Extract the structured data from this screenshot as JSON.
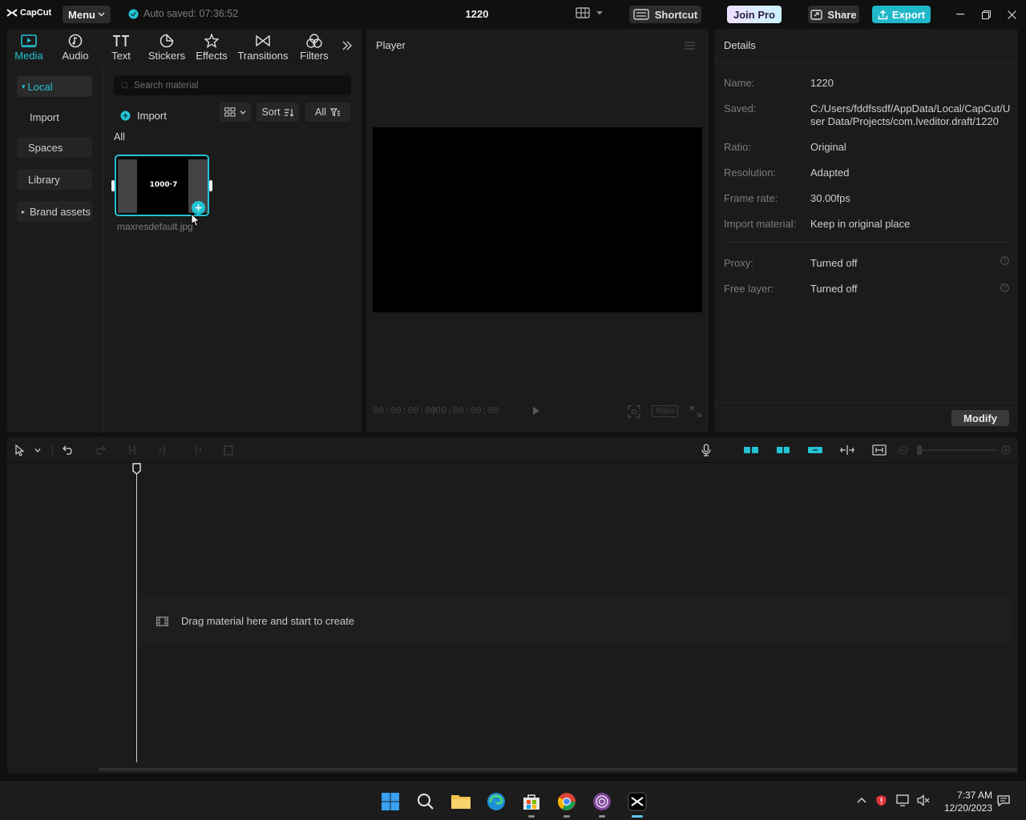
{
  "titlebar": {
    "app_name": "CapCut",
    "menu_label": "Menu",
    "autosave_text": "Auto saved: 07:36:52",
    "project_title": "1220",
    "shortcut_label": "Shortcut",
    "join_pro_label": "Join Pro",
    "share_label": "Share",
    "export_label": "Export"
  },
  "media_panel": {
    "tabs": [
      {
        "label": "Media",
        "icon": "media-icon",
        "active": true
      },
      {
        "label": "Audio",
        "icon": "audio-icon"
      },
      {
        "label": "Text",
        "icon": "text-icon"
      },
      {
        "label": "Stickers",
        "icon": "stickers-icon"
      },
      {
        "label": "Effects",
        "icon": "effects-icon"
      },
      {
        "label": "Transitions",
        "icon": "transitions-icon"
      },
      {
        "label": "Filters",
        "icon": "filters-icon"
      }
    ],
    "sidebar": [
      {
        "label": "Local",
        "active": true,
        "caret": "▾"
      },
      {
        "label": "Import"
      },
      {
        "label": "Spaces"
      },
      {
        "label": "Library"
      },
      {
        "label": "Brand assets",
        "caret": "▸"
      }
    ],
    "search_placeholder": "Search material",
    "import_label": "Import",
    "sort_label": "Sort",
    "filter_all_label": "All",
    "section_label": "All",
    "thumbnail": {
      "file_name": "maxresdefault.jpg",
      "inner_text": "1000·7"
    }
  },
  "player": {
    "title": "Player",
    "current_time": "00:00:00:00",
    "total_time": "00:00:00:00",
    "ratio_label": "Ratio"
  },
  "details": {
    "title": "Details",
    "rows": [
      {
        "key": "Name:",
        "value": "1220"
      },
      {
        "key": "Saved:",
        "value": "C:/Users/fddfssdf/AppData/Local/CapCut/User Data/Projects/com.lveditor.draft/1220"
      },
      {
        "key": "Ratio:",
        "value": "Original"
      },
      {
        "key": "Resolution:",
        "value": "Adapted"
      },
      {
        "key": "Frame rate:",
        "value": "30.00fps"
      },
      {
        "key": "Import material:",
        "value": "Keep in original place"
      },
      {
        "key": "Proxy:",
        "value": "Turned off"
      },
      {
        "key": "Free layer:",
        "value": "Turned off"
      }
    ],
    "modify_label": "Modify"
  },
  "timeline": {
    "placeholder": "Drag material here and start to create"
  },
  "taskbar": {
    "time": "7:37 AM",
    "date": "12/20/2023"
  },
  "colors": {
    "accent": "#22c3d4",
    "panel_bg": "#1b1b1b",
    "app_bg": "#101010"
  }
}
